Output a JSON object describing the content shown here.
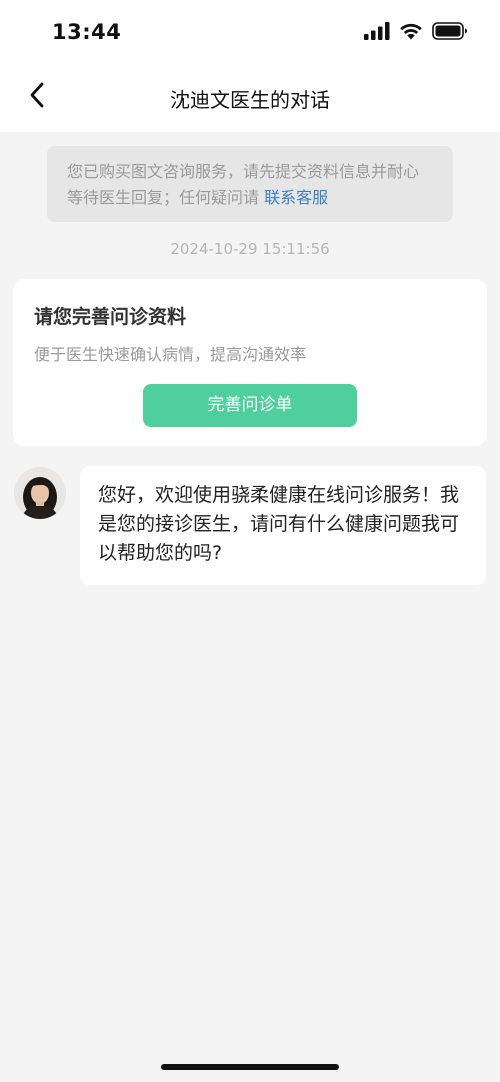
{
  "status_bar": {
    "time": "13:44"
  },
  "nav": {
    "title": "沈迪文医生的对话"
  },
  "notice": {
    "text": "您已购买图文咨询服务，请先提交资料信息并耐心等待医生回复；任何疑问请",
    "link": "联系客服"
  },
  "timestamp": "2024-10-29 15:11:56",
  "card": {
    "title": "请您完善问诊资料",
    "subtitle": "便于医生快速确认病情，提高沟通效率",
    "button": "完善问诊单"
  },
  "message": {
    "text": "您好，欢迎使用骁柔健康在线问诊服务！我是您的接诊医生，请问有什么健康问题我可以帮助您的吗?"
  },
  "colors": {
    "accent_green": "#4fcf9d",
    "link_blue": "#3b82c4",
    "background": "#f4f4f4"
  },
  "icons": [
    "signal-icon",
    "wifi-icon",
    "battery-icon",
    "back-chevron-icon",
    "doctor-avatar"
  ]
}
